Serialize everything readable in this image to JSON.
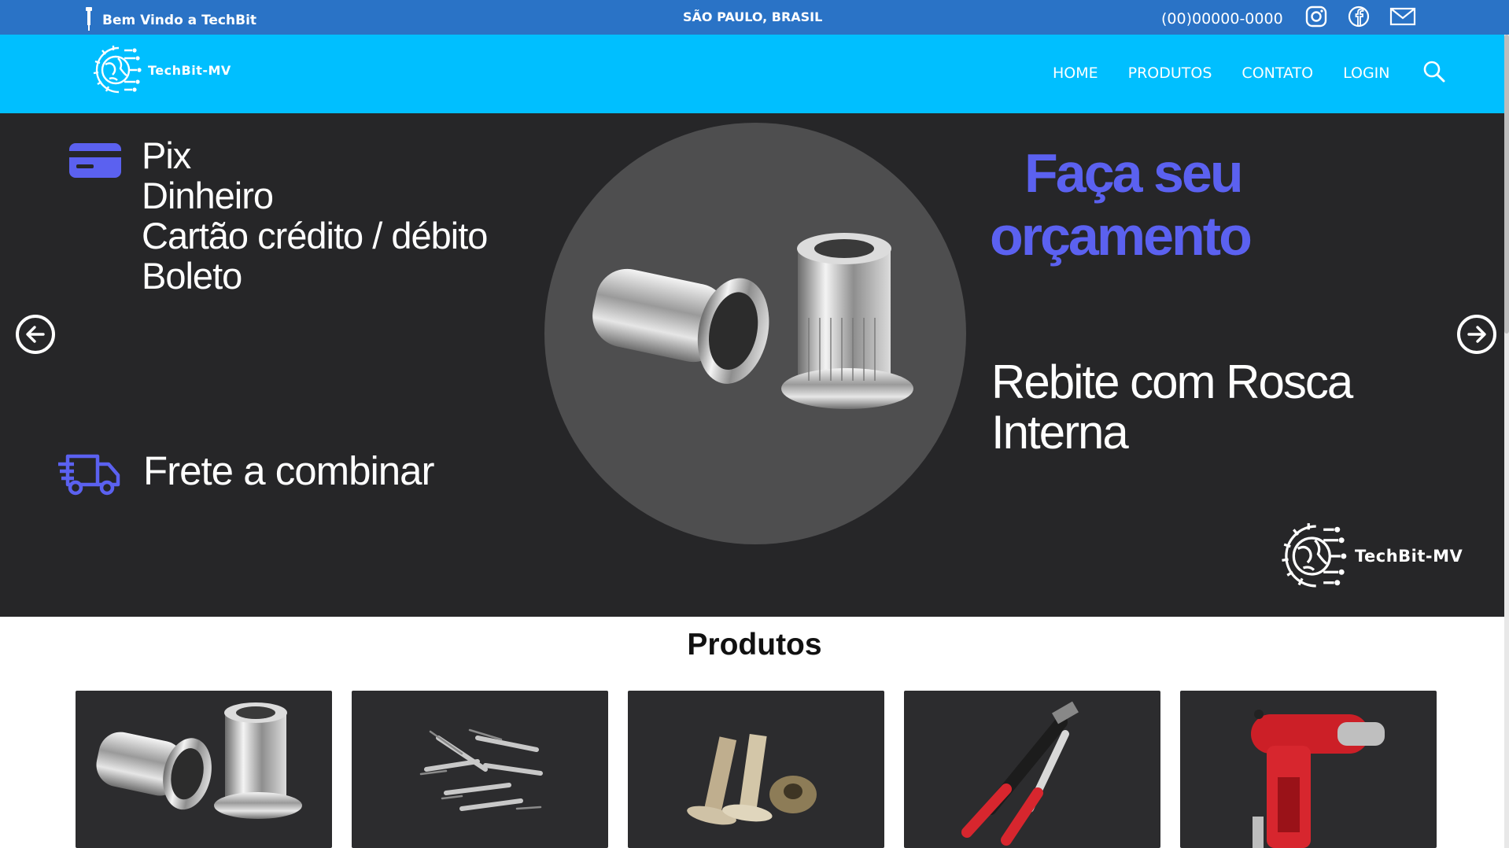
{
  "topbar": {
    "welcome": "Bem Vindo a TechBit",
    "location": "SÃO PAULO, BRASIL",
    "phone": "(00)00000-0000",
    "social": [
      "instagram-icon",
      "facebook-icon",
      "mail-icon"
    ]
  },
  "header": {
    "brand": "TechBit-MV",
    "nav": [
      "HOME",
      "PRODUTOS",
      "CONTATO",
      "LOGIN"
    ]
  },
  "hero": {
    "payments": [
      "Pix",
      "Dinheiro",
      "Cartão crédito / débito",
      "Boleto"
    ],
    "shipping": "Frete a combinar",
    "headline_line1": "Faça seu",
    "headline_line2": "orçamento",
    "product_line1": "Rebite com Rosca",
    "product_line2": "Interna",
    "brand": "TechBit-MV"
  },
  "products": {
    "title": "Produtos",
    "items": [
      "rivet-nut",
      "pop-rivets",
      "solid-rivets",
      "hand-riveter",
      "pneumatic-riveter"
    ]
  },
  "colors": {
    "topbar": "#2a73c6",
    "header": "#00bfff",
    "hero_bg": "#262628",
    "accent": "#5b61f0"
  }
}
